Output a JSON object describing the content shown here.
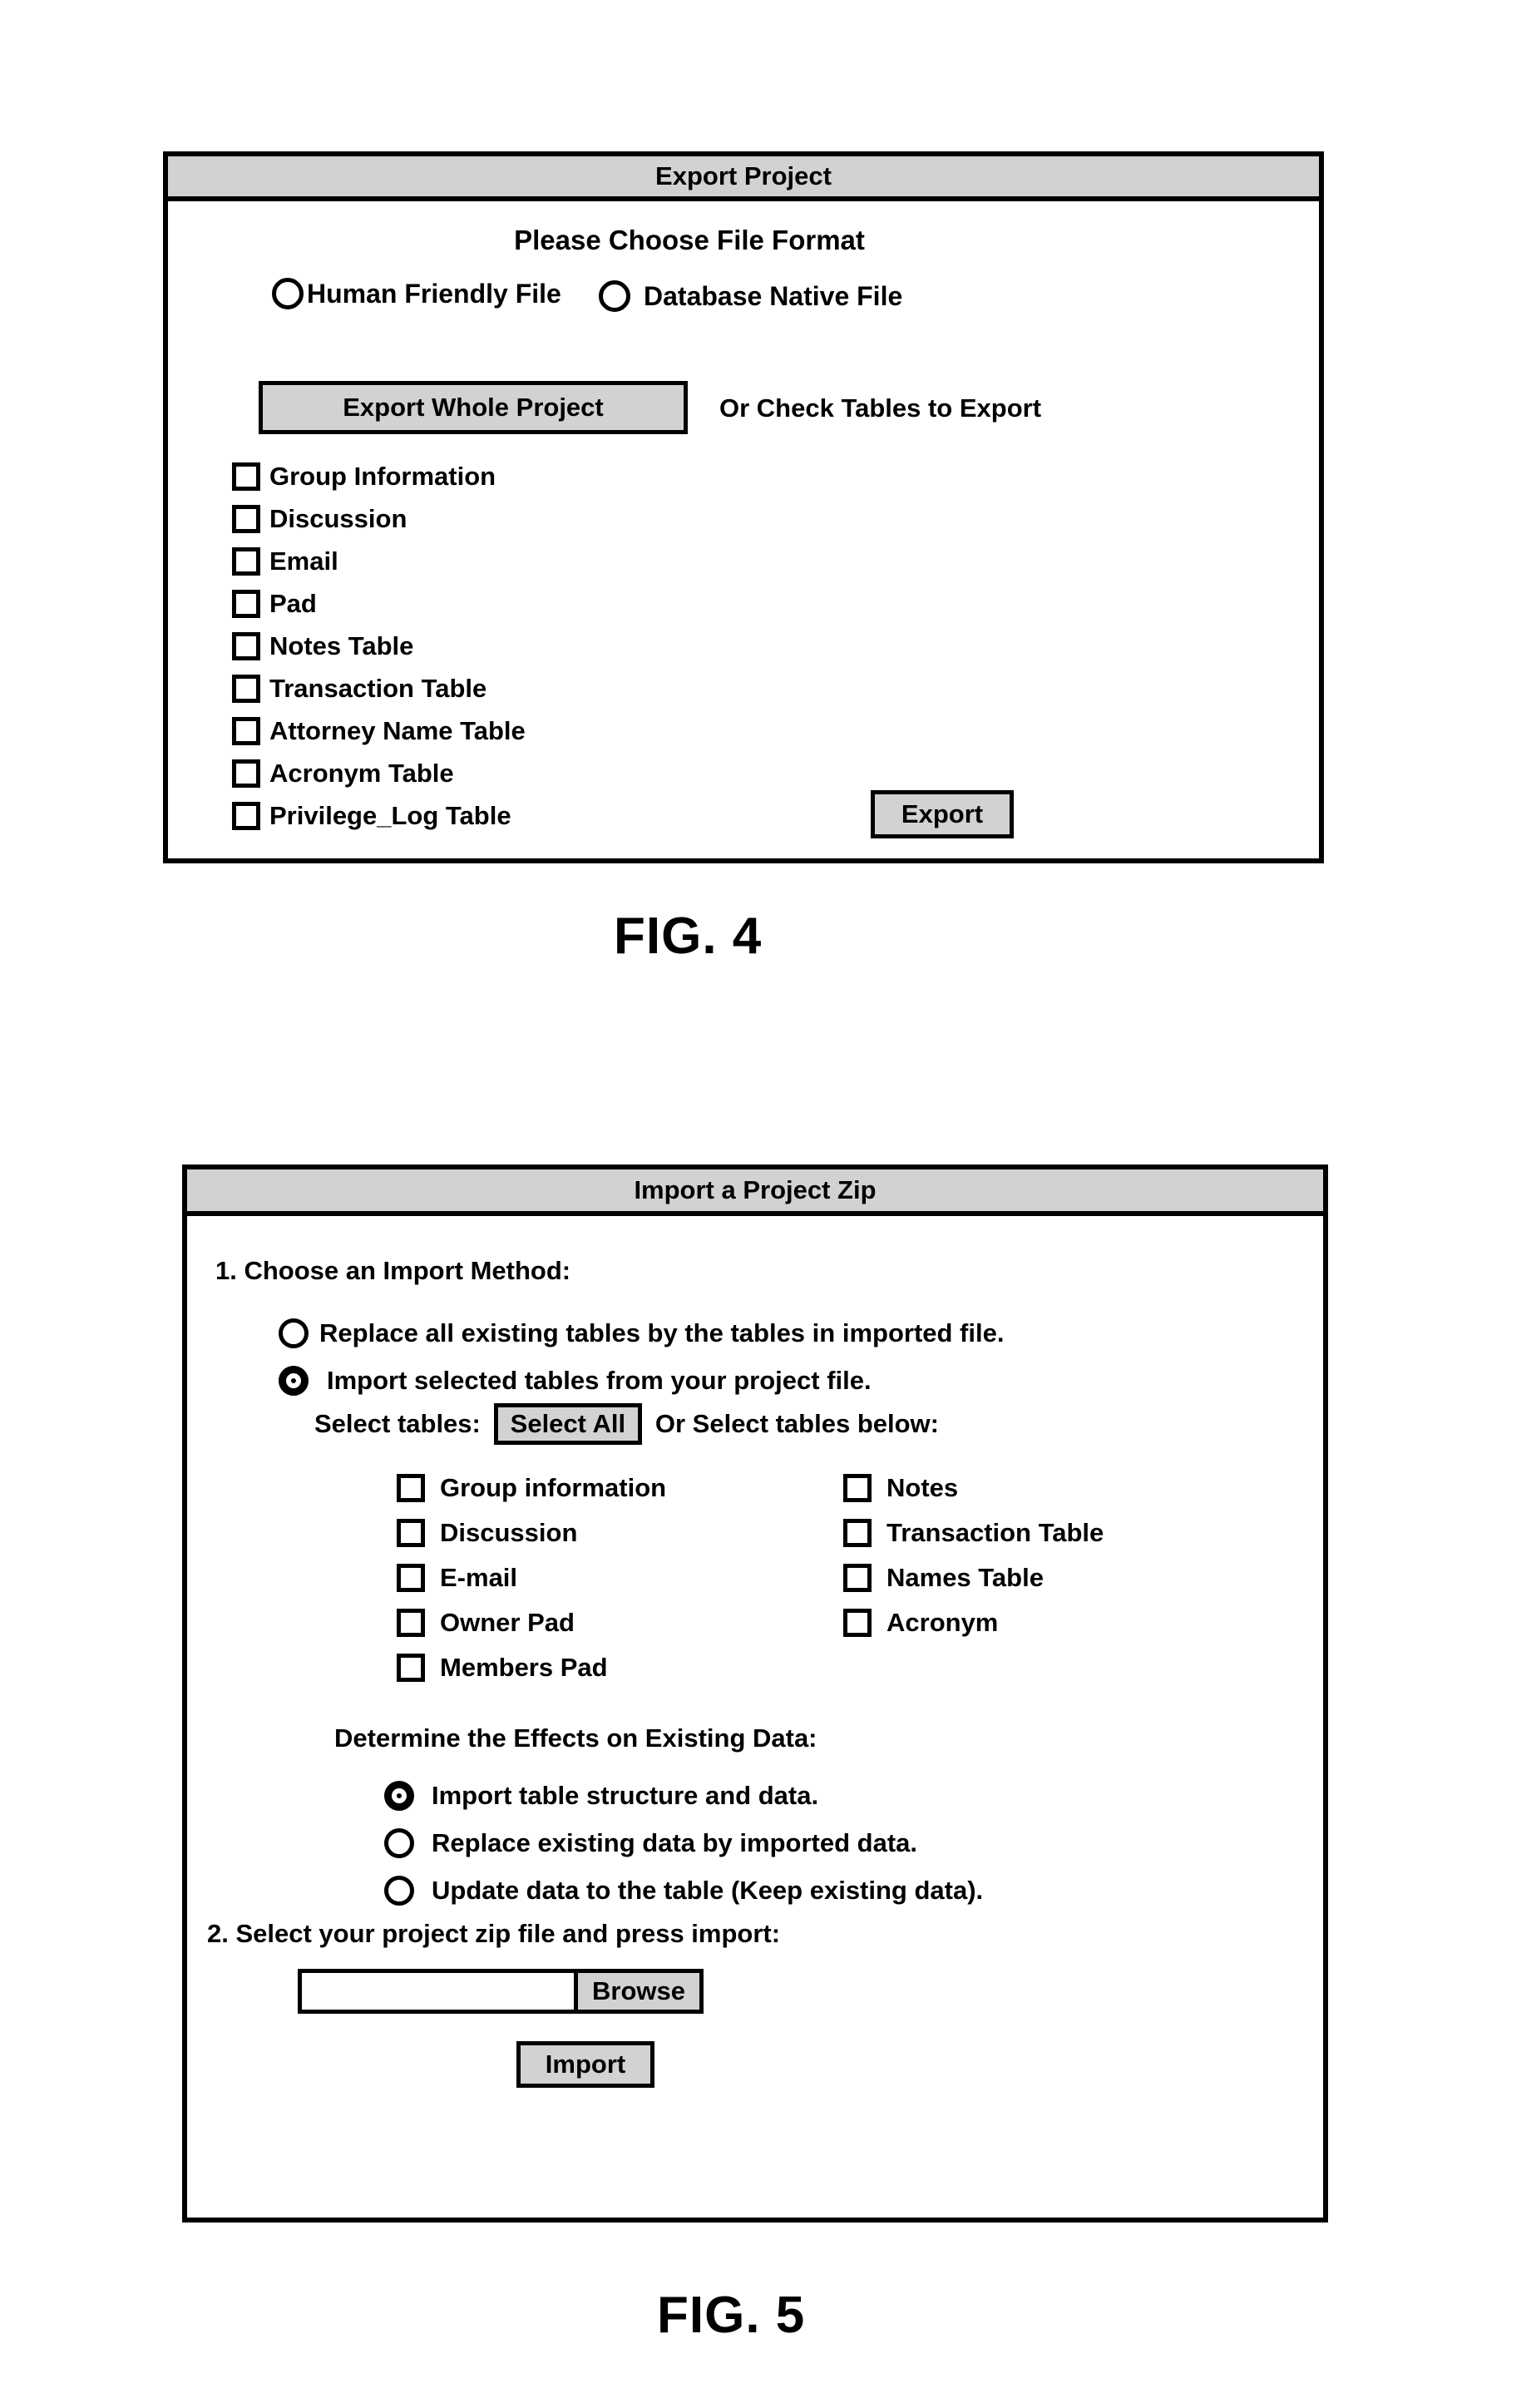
{
  "sheet": {
    "figures": [
      {
        "caption": "FIG. 4"
      },
      {
        "caption": "FIG. 5"
      }
    ]
  },
  "fig4": {
    "caption": "FIG. 4",
    "title": "Export Project",
    "heading": "Please Choose File Format",
    "format_options": [
      {
        "label": "Human Friendly File",
        "selected": false
      },
      {
        "label": "Database Native File",
        "selected": false
      }
    ],
    "export_whole_button": "Export Whole Project",
    "or_check_label": "Or Check Tables to Export",
    "tables": [
      {
        "label": "Group Information",
        "checked": false
      },
      {
        "label": "Discussion",
        "checked": false
      },
      {
        "label": "Email",
        "checked": false
      },
      {
        "label": "Pad",
        "checked": false
      },
      {
        "label": "Notes Table",
        "checked": false
      },
      {
        "label": "Transaction Table",
        "checked": false
      },
      {
        "label": "Attorney Name Table",
        "checked": false
      },
      {
        "label": "Acronym Table",
        "checked": false
      },
      {
        "label": "Privilege_Log Table",
        "checked": false
      }
    ],
    "export_button": "Export"
  },
  "fig5": {
    "caption": "FIG. 5",
    "title": "Import a Project Zip",
    "step1_label": "1. Choose an Import Method:",
    "import_methods": [
      {
        "label": "Replace all existing tables by the tables in imported file.",
        "selected": false
      },
      {
        "label": "Import selected tables from your project file.",
        "selected": true
      }
    ],
    "select_tables_label": "Select tables:",
    "select_all_button": "Select All",
    "or_select_below_label": "Or Select tables below:",
    "tables_left": [
      {
        "label": "Group information",
        "checked": false
      },
      {
        "label": "Discussion",
        "checked": false
      },
      {
        "label": "E-mail",
        "checked": false
      },
      {
        "label": "Owner Pad",
        "checked": false
      },
      {
        "label": "Members Pad",
        "checked": false
      }
    ],
    "tables_right": [
      {
        "label": "Notes",
        "checked": false
      },
      {
        "label": "Transaction Table",
        "checked": false
      },
      {
        "label": "Names Table",
        "checked": false
      },
      {
        "label": "Acronym",
        "checked": false
      }
    ],
    "effects_title": "Determine the Effects on Existing Data:",
    "effects_options": [
      {
        "label": "Import table structure and data.",
        "selected": true
      },
      {
        "label": "Replace existing data by imported data.",
        "selected": false
      },
      {
        "label": "Update data to the table (Keep existing data).",
        "selected": false
      }
    ],
    "step2_label": "2. Select your project zip file and press import:",
    "file_path_value": "",
    "file_path_placeholder": "",
    "browse_button": "Browse",
    "import_button": "Import"
  },
  "colors": {
    "panel_border": "#000000",
    "titlebar_fill": "#d2d2d2",
    "button_fill": "#d2d2d2",
    "page_background": "#ffffff",
    "text": "#000000"
  }
}
